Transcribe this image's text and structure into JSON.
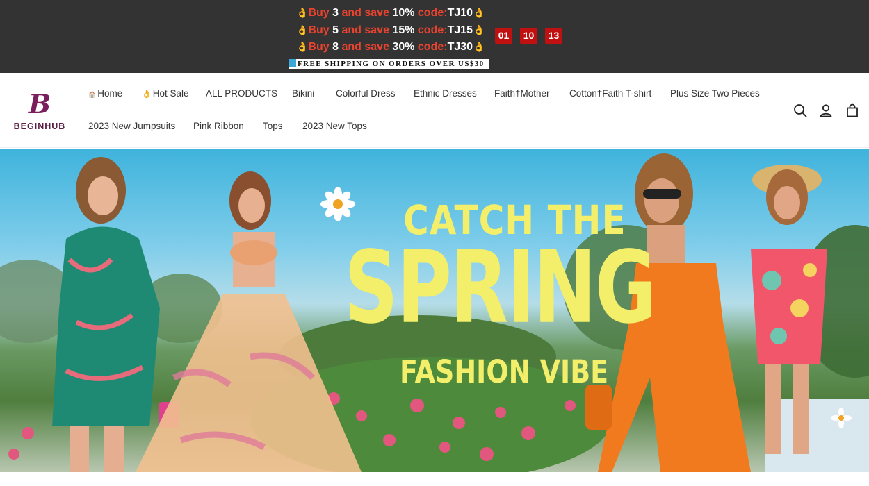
{
  "announcement": {
    "promos": [
      {
        "buy": "Buy",
        "qty": "3",
        "and_save": "and save",
        "pct": "10%",
        "code_label": "code:",
        "code": "TJ10"
      },
      {
        "buy": "Buy",
        "qty": "5",
        "and_save": "and save",
        "pct": "15%",
        "code_label": "code:",
        "code": "TJ15"
      },
      {
        "buy": "Buy",
        "qty": "8",
        "and_save": "and save",
        "pct": "30%",
        "code_label": "code:",
        "code": "TJ30"
      }
    ],
    "hand_icon": "👌",
    "countdown": [
      "01",
      "10",
      "13"
    ],
    "shipping_text": "FREE SHIPPING ON ORDERS OVER US$30"
  },
  "header": {
    "logo_mark": "B",
    "logo_text": "BEGINHUB",
    "nav": [
      {
        "label": "Home",
        "icon": "home-icon"
      },
      {
        "label": "Hot Sale",
        "icon": "hand-icon"
      },
      {
        "label": "ALL PRODUCTS"
      },
      {
        "label": "Bikini"
      },
      {
        "label": "Colorful Dress"
      },
      {
        "label": "Ethnic Dresses"
      },
      {
        "label": "Faith†Mother"
      },
      {
        "label": "Cotton†Faith T-shirt"
      },
      {
        "label": "Plus Size Two Pieces"
      },
      {
        "label": "2023 New Jumpsuits"
      },
      {
        "label": "Pink Ribbon"
      },
      {
        "label": "Tops"
      },
      {
        "label": "2023 New Tops"
      }
    ],
    "icons": [
      "search-icon",
      "account-icon",
      "cart-icon"
    ]
  },
  "hero": {
    "line1": "CATCH THE",
    "line2": "SPRING",
    "line3": "FASHION VIBE"
  },
  "colors": {
    "announce_bg": "#333333",
    "promo_red": "#e8432e",
    "countdown_bg": "#c0100f",
    "hero_text": "#f3ef6a",
    "logo": "#7a1f5c"
  }
}
